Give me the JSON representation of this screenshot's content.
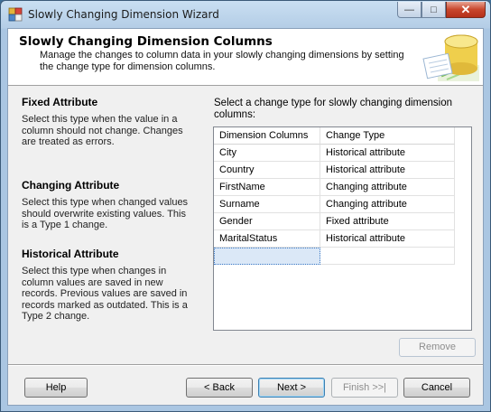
{
  "window": {
    "title": "Slowly Changing Dimension Wizard"
  },
  "header": {
    "title": "Slowly Changing Dimension Columns",
    "subtitle": "Manage the changes to column data in your slowly changing dimensions by setting the change type for dimension columns."
  },
  "left_sections": [
    {
      "heading": "Fixed Attribute",
      "text": "Select this type when the value in a column should not change. Changes are treated as errors."
    },
    {
      "heading": "Changing Attribute",
      "text": "Select this type when changed values should overwrite existing values. This is a Type 1 change."
    },
    {
      "heading": "Historical Attribute",
      "text": "Select this type when changes in column values are saved in new records. Previous values are saved in records marked as outdated. This is a Type 2 change."
    }
  ],
  "instruction": "Select a change type for slowly changing dimension columns:",
  "grid": {
    "columns": [
      "Dimension Columns",
      "Change Type"
    ],
    "rows": [
      [
        "City",
        "Historical attribute"
      ],
      [
        "Country",
        "Historical attribute"
      ],
      [
        "FirstName",
        "Changing attribute"
      ],
      [
        "Surname",
        "Changing attribute"
      ],
      [
        "Gender",
        "Fixed attribute"
      ],
      [
        "MaritalStatus",
        "Historical attribute"
      ]
    ]
  },
  "buttons": {
    "remove": "Remove",
    "help": "Help",
    "back": "< Back",
    "next": "Next >",
    "finish": "Finish >>|",
    "cancel": "Cancel"
  },
  "icons": {
    "app": "wizard-app-icon",
    "header_art": "database-cylinder-icon"
  }
}
